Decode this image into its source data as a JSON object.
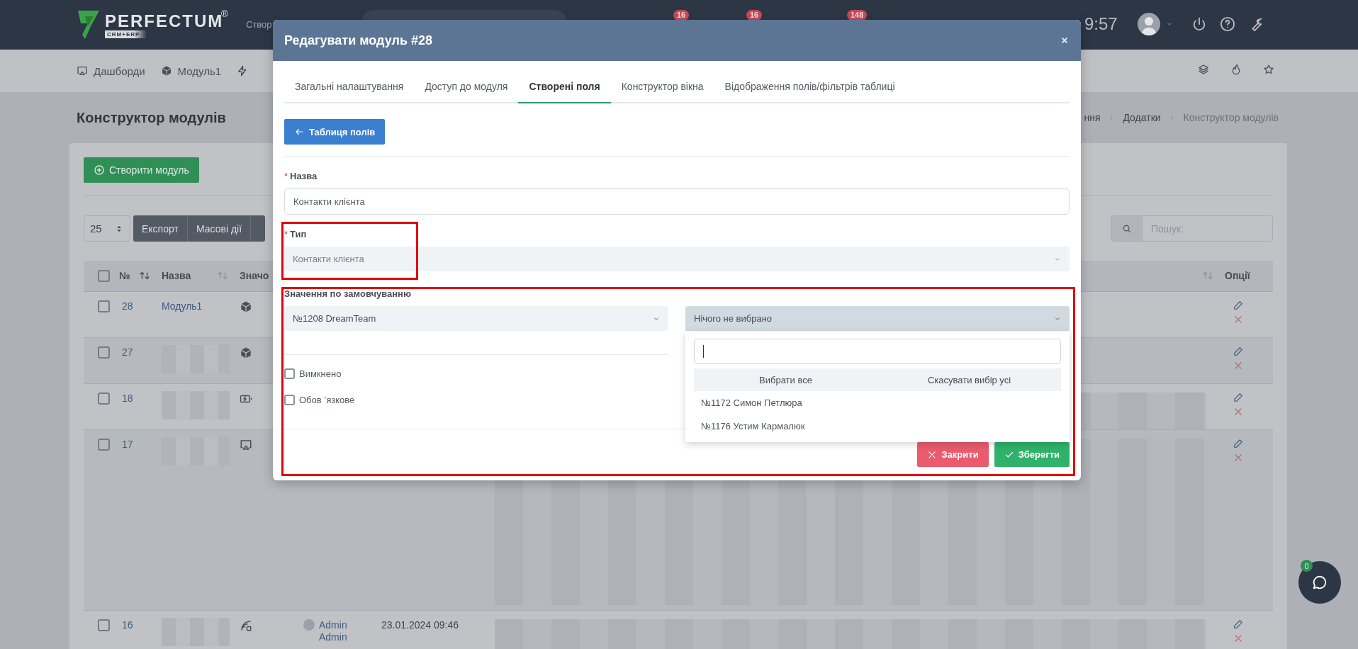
{
  "topbar": {
    "logo": "PERFECTUM",
    "logo_mark": "®",
    "logo_sub": "CRM+ERP",
    "menu_item": "Створ",
    "badges": [
      "16",
      "16",
      "148"
    ],
    "time": "9:57"
  },
  "navbar": {
    "items": [
      "Дашборди",
      "Модуль1"
    ]
  },
  "page": {
    "title": "Конструктор модулів",
    "breadcrumbs": [
      "ння",
      "Додатки",
      "Конструктор модулів"
    ]
  },
  "toolbar": {
    "create_button": "Створити модуль",
    "page_size": "25",
    "buttons": [
      "Експорт",
      "Масові дії"
    ],
    "search_placeholder": "Пошук:"
  },
  "table": {
    "header_checked": false,
    "columns": [
      "№",
      "Назва",
      "Значо",
      "Опції"
    ],
    "rows": [
      {
        "checked": false,
        "number": "28",
        "name": "Модуль1"
      },
      {
        "checked": false,
        "number": "27",
        "name_redacted": true
      },
      {
        "checked": false,
        "number": "18",
        "name_redacted": true,
        "details_redacted": true
      },
      {
        "checked": false,
        "number": "17",
        "name_redacted": true,
        "details_redacted": true
      },
      {
        "checked": false,
        "number": "16",
        "name_redacted": true,
        "details_redacted": true,
        "author": [
          "Admin",
          "Admin"
        ],
        "date": "23.01.2024 09:46"
      }
    ]
  },
  "modal": {
    "title": "Редагувати модуль #28",
    "tabs": [
      {
        "label": "Загальні налаштування",
        "selected": false
      },
      {
        "label": "Доступ до модуля",
        "selected": false
      },
      {
        "label": "Створені поля",
        "selected": true
      },
      {
        "label": "Конструктор вікна",
        "selected": false
      },
      {
        "label": "Відображення полів/фільтрів таблиці",
        "selected": false
      }
    ],
    "back_button": "Таблиця полів",
    "fields": [
      {
        "kind": "input",
        "label": "Назва",
        "required_mark": "*",
        "value": "Контакти клієнта"
      },
      {
        "kind": "select",
        "label": "Тип",
        "required_mark": "*",
        "value": "Контакти клієнта",
        "highlighted": true
      }
    ],
    "default_value": {
      "label": "Значення по замовчуванню",
      "highlighted": true,
      "select": "№1208 DreamTeam",
      "multiselect": {
        "value_text": "Нічого не вибрано",
        "expanded": true,
        "select_all": "Вибрати все",
        "deselect_all": "Скасувати вибір усі",
        "options": [
          {
            "label": "№1172 Симон Петлюра",
            "selected": false
          },
          {
            "label": "№1176 Устим Кармалюк",
            "selected": false
          }
        ]
      }
    },
    "checkboxes": [
      {
        "label": "Вимкнено",
        "checked": false
      },
      {
        "label": "Обов ʼязкове",
        "checked": false
      }
    ],
    "buttons": [
      {
        "kind": "close",
        "label": "Закрити"
      },
      {
        "kind": "save",
        "label": "Зберегти"
      }
    ]
  },
  "chat": {
    "count": "0"
  }
}
